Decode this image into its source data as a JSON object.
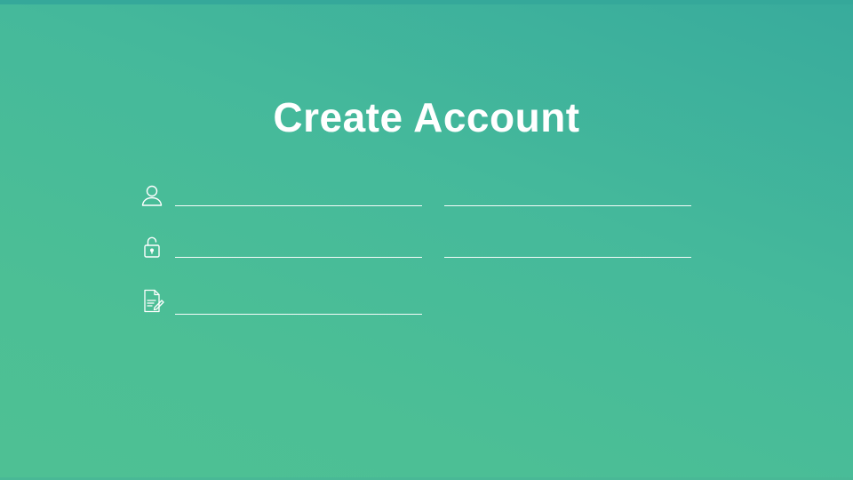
{
  "page": {
    "title": "Create Account"
  },
  "form": {
    "row1": {
      "icon": "user-icon",
      "left_value": "",
      "left_placeholder": "",
      "right_value": "",
      "right_placeholder": ""
    },
    "row2": {
      "icon": "unlock-icon",
      "left_value": "",
      "left_placeholder": "",
      "right_value": "",
      "right_placeholder": ""
    },
    "row3": {
      "icon": "document-edit-icon",
      "value": "",
      "placeholder": ""
    }
  },
  "colors": {
    "background_top": "#38ab9c",
    "background_bottom": "#4ec094",
    "text": "#ffffff",
    "underline": "#ffffff"
  }
}
